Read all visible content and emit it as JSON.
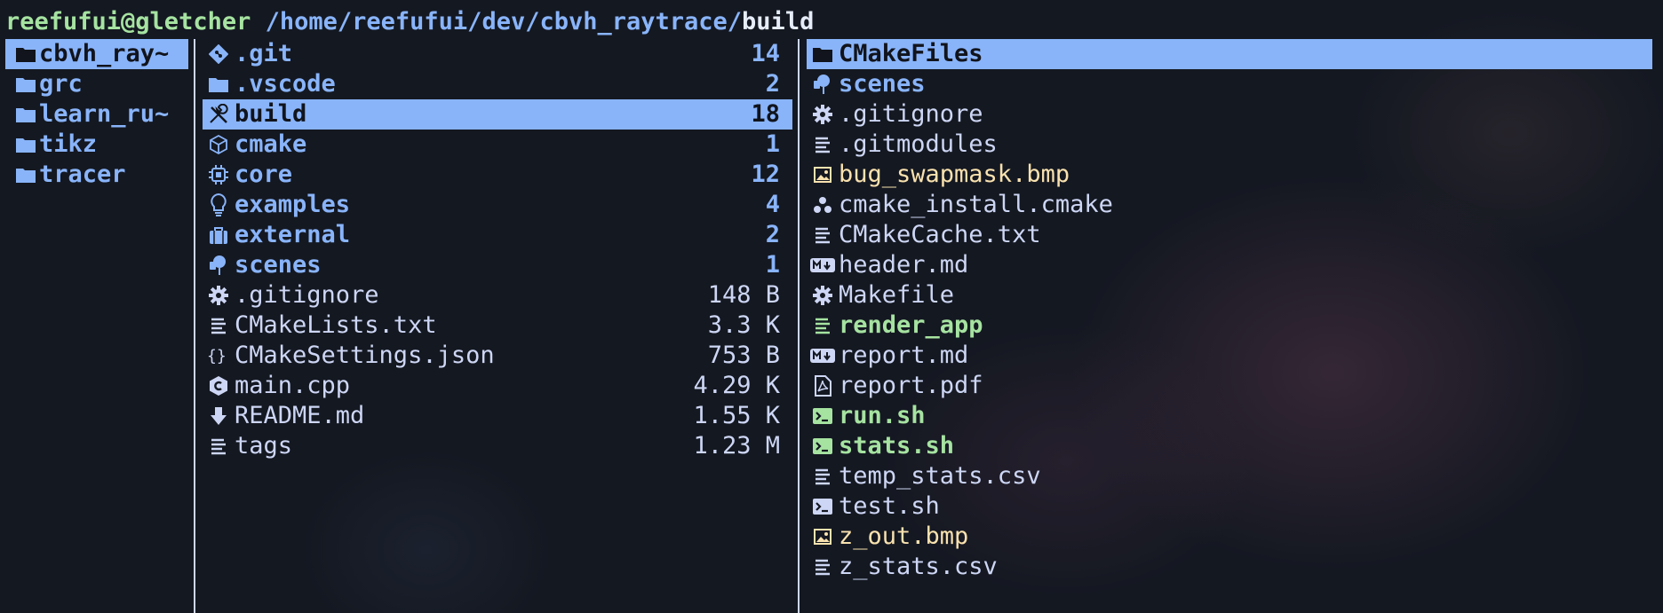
{
  "prompt": {
    "user_host": "reefufui@gletcher",
    "path": "/home/reefufui/dev/cbvh_raytrace/",
    "current": "build"
  },
  "parent_column": [
    {
      "name": "cbvh_ray~",
      "icon": "folder-icon",
      "selected": true
    },
    {
      "name": "grc",
      "icon": "folder-icon"
    },
    {
      "name": "learn_ru~",
      "icon": "folder-icon"
    },
    {
      "name": "tikz",
      "icon": "folder-icon"
    },
    {
      "name": "tracer",
      "icon": "folder-icon"
    }
  ],
  "current_column": [
    {
      "name": ".git",
      "icon": "git-icon",
      "kind": "dir",
      "size": "14"
    },
    {
      "name": ".vscode",
      "icon": "folder-icon",
      "kind": "dir",
      "size": "2"
    },
    {
      "name": "build",
      "icon": "tools-icon",
      "kind": "dir",
      "size": "18",
      "selected": true
    },
    {
      "name": "cmake",
      "icon": "cube-icon",
      "kind": "dir",
      "size": "1"
    },
    {
      "name": "core",
      "icon": "chip-icon",
      "kind": "dir",
      "size": "12"
    },
    {
      "name": "examples",
      "icon": "lightbulb-icon",
      "kind": "dir",
      "size": "4"
    },
    {
      "name": "external",
      "icon": "briefcase-icon",
      "kind": "dir",
      "size": "2"
    },
    {
      "name": "scenes",
      "icon": "scene-icon",
      "kind": "dir",
      "size": "1"
    },
    {
      "name": ".gitignore",
      "icon": "gear-icon",
      "kind": "file",
      "size": "148 B"
    },
    {
      "name": "CMakeLists.txt",
      "icon": "text-file-icon",
      "kind": "file",
      "size": "3.3 K"
    },
    {
      "name": "CMakeSettings.json",
      "icon": "json-icon",
      "kind": "file",
      "size": "753 B"
    },
    {
      "name": "main.cpp",
      "icon": "cpp-icon",
      "kind": "file",
      "size": "4.29 K"
    },
    {
      "name": "README.md",
      "icon": "download-arrow-icon",
      "kind": "file",
      "size": "1.55 K"
    },
    {
      "name": "tags",
      "icon": "text-file-icon",
      "kind": "file",
      "size": "1.23 M"
    }
  ],
  "preview_column": [
    {
      "name": "CMakeFiles",
      "icon": "folder-icon",
      "kind": "dir",
      "selected": true
    },
    {
      "name": "scenes",
      "icon": "scene-icon",
      "kind": "dir"
    },
    {
      "name": ".gitignore",
      "icon": "gear-icon",
      "kind": "file"
    },
    {
      "name": ".gitmodules",
      "icon": "text-file-icon",
      "kind": "file"
    },
    {
      "name": "bug_swapmask.bmp",
      "icon": "image-icon",
      "kind": "img"
    },
    {
      "name": "cmake_install.cmake",
      "icon": "cmake-icon",
      "kind": "file"
    },
    {
      "name": "CMakeCache.txt",
      "icon": "text-file-icon",
      "kind": "file"
    },
    {
      "name": "header.md",
      "icon": "markdown-icon",
      "kind": "file"
    },
    {
      "name": "Makefile",
      "icon": "gear-icon",
      "kind": "file"
    },
    {
      "name": "render_app",
      "icon": "text-file-icon",
      "kind": "exe"
    },
    {
      "name": "report.md",
      "icon": "markdown-icon",
      "kind": "file"
    },
    {
      "name": "report.pdf",
      "icon": "pdf-icon",
      "kind": "file"
    },
    {
      "name": "run.sh",
      "icon": "terminal-icon",
      "kind": "exe"
    },
    {
      "name": "stats.sh",
      "icon": "terminal-icon",
      "kind": "exe"
    },
    {
      "name": "temp_stats.csv",
      "icon": "text-file-icon",
      "kind": "file"
    },
    {
      "name": "test.sh",
      "icon": "terminal-icon",
      "kind": "file"
    },
    {
      "name": "z_out.bmp",
      "icon": "image-icon",
      "kind": "img"
    },
    {
      "name": "z_stats.csv",
      "icon": "text-file-icon",
      "kind": "file"
    }
  ],
  "colors": {
    "background": "#141821",
    "directory": "#89b4fa",
    "file": "#cdd6f4",
    "image": "#f9e2af",
    "executable": "#a6e3a1",
    "selection": "#89b4fa"
  }
}
